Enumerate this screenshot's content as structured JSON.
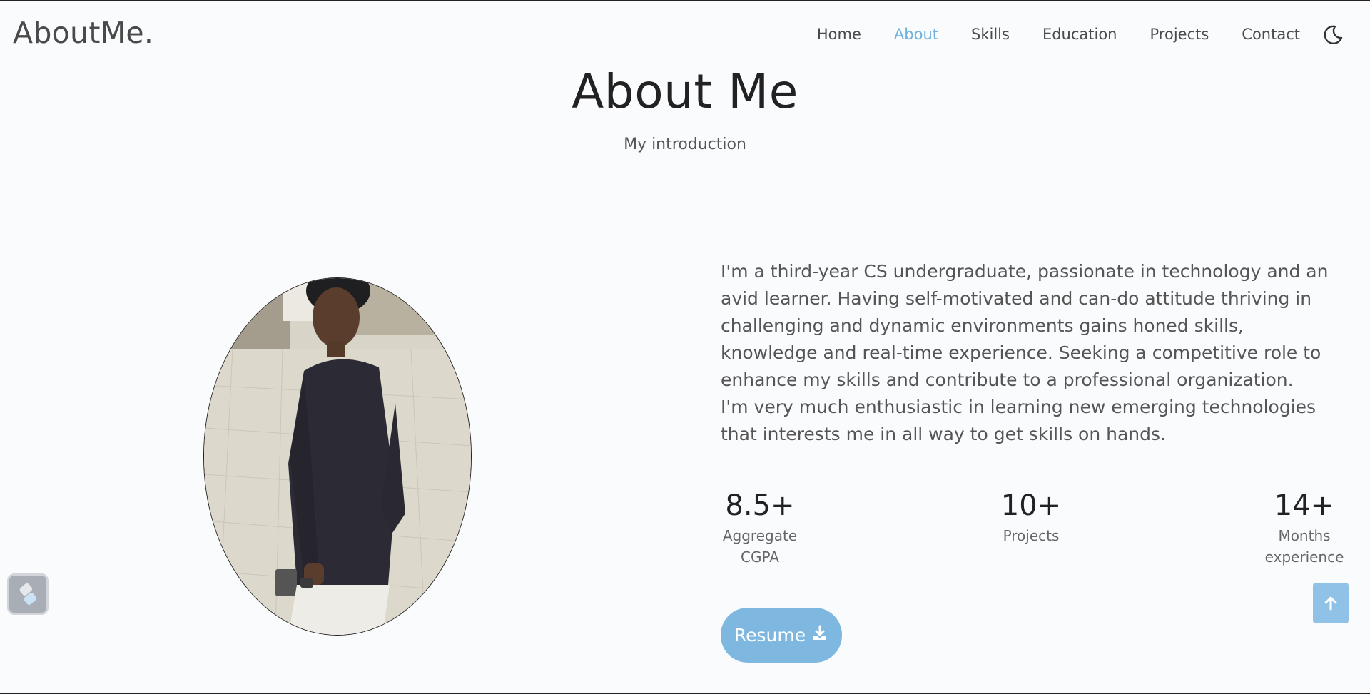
{
  "header": {
    "logo": "AboutMe.",
    "nav": [
      {
        "label": "Home"
      },
      {
        "label": "About",
        "active": true
      },
      {
        "label": "Skills"
      },
      {
        "label": "Education"
      },
      {
        "label": "Projects"
      },
      {
        "label": "Contact"
      }
    ],
    "theme_toggle_icon": "moon-icon"
  },
  "section": {
    "title": "About Me",
    "subtitle": "My introduction"
  },
  "about": {
    "paragraph1": "I'm a third-year CS undergraduate, passionate in technology and an avid learner. Having self-motivated and can-do attitude thriving in challenging and dynamic environments gains honed skills, knowledge and real-time experience. Seeking a competitive role to enhance my skills and contribute to a professional organization.",
    "paragraph2": "I'm very much enthusiastic in learning new emerging technologies that interests me in all way to get skills on hands."
  },
  "stats": [
    {
      "value": "8.5+",
      "label_line1": "Aggregate",
      "label_line2": "CGPA"
    },
    {
      "value": "10+",
      "label_line1": "Projects",
      "label_line2": ""
    },
    {
      "value": "14+",
      "label_line1": "Months",
      "label_line2": "experience"
    }
  ],
  "resume_button": {
    "label": "Resume",
    "icon": "download-icon"
  },
  "floating": {
    "widget_icon": "extension-icon",
    "scroll_top_icon": "arrow-up-icon"
  },
  "colors": {
    "accent": "#6eb1dc",
    "button": "#7eb8e0",
    "background": "#fafbfd"
  }
}
